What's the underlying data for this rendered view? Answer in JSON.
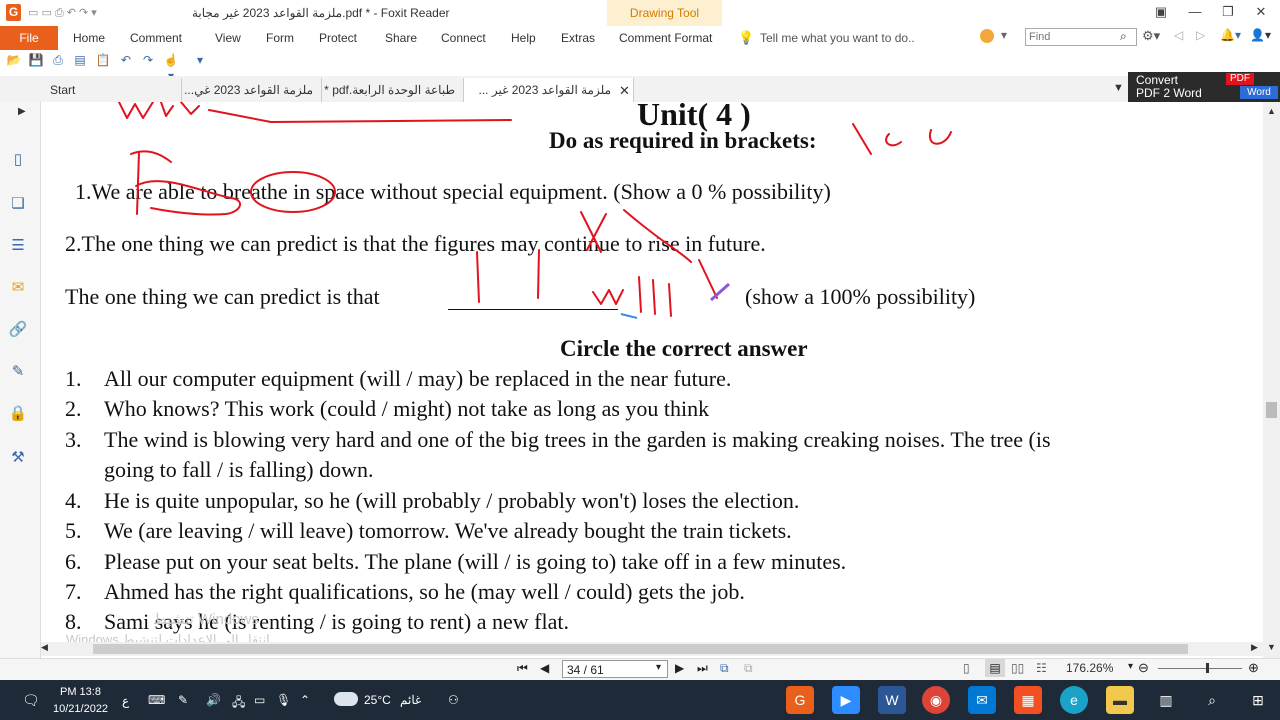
{
  "titlebar": {
    "title": "ملزمة القواعد 2023 غير مجابة.pdf * - Foxit Reader",
    "context_tab": "Drawing Tool",
    "app_icon": "G"
  },
  "menu": {
    "file": "File",
    "items": [
      "Home",
      "Comment",
      "View",
      "Form",
      "Protect",
      "Share",
      "Connect",
      "Help",
      "Extras",
      "Comment Format"
    ],
    "tell_me": "Tell me what you want to do..",
    "find_placeholder": "Find"
  },
  "tabs": {
    "start": "Start",
    "tab1": "ملزمة القواعد 2023 غي...",
    "tab2": "طباعة الوحدة الرابعة.pdf *",
    "tab3": "ملزمة القواعد 2023 غير ...",
    "convert_line1": "Convert",
    "convert_line2": "PDF 2 Word",
    "badge_pdf": "PDF",
    "badge_word": "Word"
  },
  "document": {
    "unit_title": "Unit( 4 )",
    "section1": "Do as required in brackets:",
    "q1": "1.We are able to breathe in space without special equipment. (Show a 0 % possibility)",
    "q2": "2.The one thing we can predict is that the figures may continue to rise in future.",
    "q2_answer_prefix": "The one thing we can predict is that",
    "q2_answer_suffix": "(show a 100% possibility)",
    "section2": "Circle the correct answer",
    "items": [
      {
        "n": "1.",
        "text": "All our computer equipment (will / may) be replaced in the near future."
      },
      {
        "n": "2.",
        "text": "Who knows? This work (could / might) not take as long as you think"
      },
      {
        "n": "3.",
        "text": "The wind is blowing very hard and one of the big trees in the garden is making creaking noises. The tree (is"
      },
      {
        "n": "",
        "text": "going to fall / is falling) down."
      },
      {
        "n": "4.",
        "text": "He is quite unpopular, so he (will probably / probably won't) loses the election."
      },
      {
        "n": "5.",
        "text": "We (are leaving / will leave) tomorrow. We've already bought the train tickets."
      },
      {
        "n": "6.",
        "text": "Please put on your seat belts. The plane (will / is going to) take off in a few minutes."
      },
      {
        "n": "7.",
        "text": "Ahmed has the right qualifications, so he (may well / could) gets the job."
      },
      {
        "n": "8.",
        "text": "Sami says he (is renting / is going to rent) a new flat."
      }
    ],
    "watermark_activate": "Windows تنشيط",
    "watermark_settings": "انتقل إلى الإعدادات لتنشيط Windows"
  },
  "statusbar": {
    "page": "34 / 61",
    "zoom": "176.26%"
  },
  "taskbar": {
    "time": "PM 13:8",
    "date": "10/21/2022",
    "lang": "ع",
    "weather_temp": "25°C",
    "weather_text": "غائم"
  },
  "colors": {
    "accent": "#e8601c",
    "ink": "#e0141e",
    "taskbar": "#1e2a38"
  }
}
